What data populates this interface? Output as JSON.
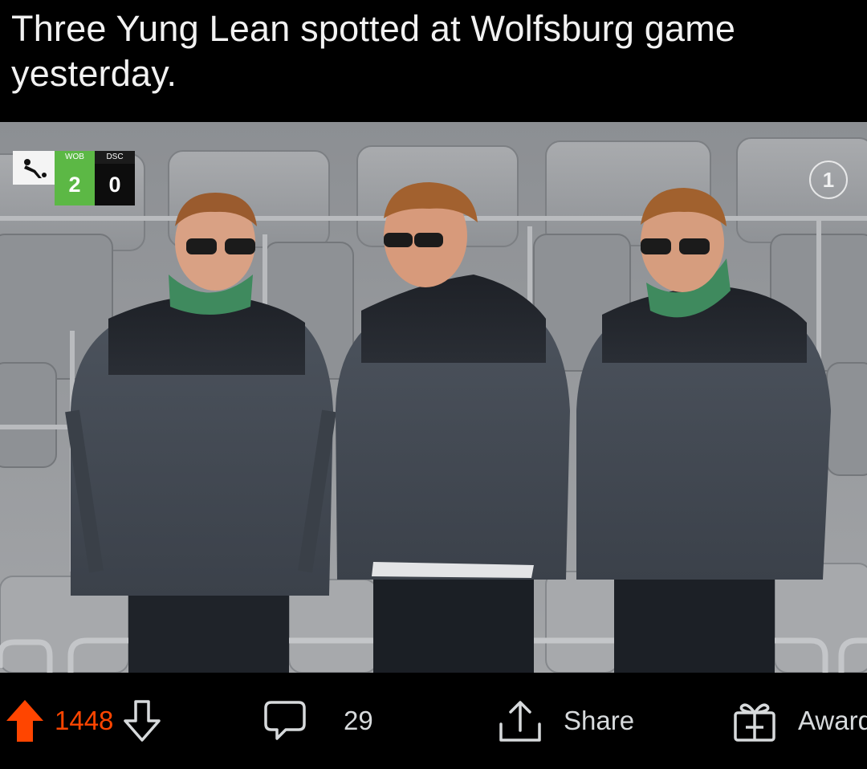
{
  "post": {
    "title": "Three Yung Lean spotted at Wolfsburg game yesterday."
  },
  "scoreboard": {
    "home_team": "WOB",
    "away_team": "DSC",
    "home_score": "2",
    "away_score": "0",
    "home_color": "#5cb845"
  },
  "channel_logo_text": "1",
  "actions": {
    "upvote_count": "1448",
    "comment_count": "29",
    "share_label": "Share",
    "award_label": "Award"
  },
  "colors": {
    "upvote": "#ff4500",
    "text": "#d7dadc",
    "background": "#000000"
  },
  "icons": [
    "upvote-arrow-icon",
    "downvote-arrow-icon",
    "comment-bubble-icon",
    "share-icon",
    "award-gift-icon"
  ]
}
